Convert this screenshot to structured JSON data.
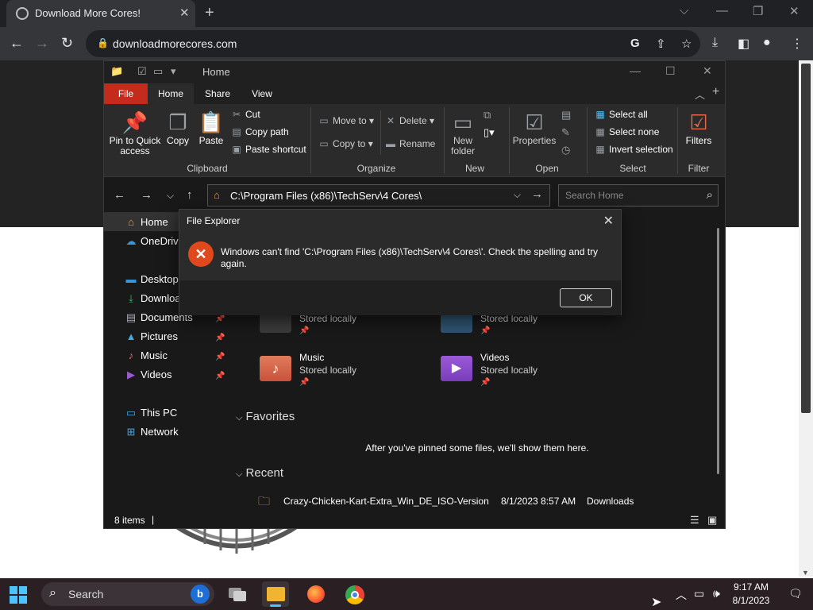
{
  "browser": {
    "tab_title": "Download More Cores!",
    "url": "downloadmorecores.com"
  },
  "explorer": {
    "location_title": "Home",
    "ribbon_tabs": [
      "File",
      "Home",
      "Share",
      "View"
    ],
    "clipboard": {
      "pin_label": "Pin to Quick access",
      "copy_label": "Copy",
      "paste_label": "Paste",
      "cut_label": "Cut",
      "copy_path_label": "Copy path",
      "paste_shortcut_label": "Paste shortcut",
      "group_label": "Clipboard"
    },
    "organize": {
      "move_to_label": "Move to",
      "copy_to_label": "Copy to",
      "delete_label": "Delete",
      "rename_label": "Rename",
      "group_label": "Organize"
    },
    "new": {
      "new_folder_label": "New folder",
      "group_label": "New"
    },
    "open": {
      "properties_label": "Properties",
      "group_label": "Open"
    },
    "select": {
      "select_all_label": "Select all",
      "select_none_label": "Select none",
      "invert_label": "Invert selection",
      "group_label": "Select"
    },
    "filter": {
      "filters_label": "Filters",
      "group_label": "Filter"
    },
    "address_path": "C:\\Program Files (x86)\\TechServ\\4 Cores\\",
    "search_placeholder": "Search Home",
    "nav": [
      {
        "label": "Home",
        "icon": "home-icon"
      },
      {
        "label": "OneDrive",
        "icon": "cloud-icon"
      },
      {
        "label": "Desktop",
        "icon": "desktop-icon"
      },
      {
        "label": "Downloads",
        "icon": "download-icon"
      },
      {
        "label": "Documents",
        "icon": "document-icon"
      },
      {
        "label": "Pictures",
        "icon": "picture-icon"
      },
      {
        "label": "Music",
        "icon": "music-icon"
      },
      {
        "label": "Videos",
        "icon": "video-icon"
      },
      {
        "label": "This PC",
        "icon": "computer-icon"
      },
      {
        "label": "Network",
        "icon": "network-icon"
      }
    ],
    "quick_access": [
      {
        "name": "",
        "status": "Stored locally",
        "icon": "document-folder-icon"
      },
      {
        "name": "",
        "status": "Stored locally",
        "icon": "picture-folder-icon"
      },
      {
        "name": "Music",
        "status": "Stored locally",
        "icon": "music-folder-icon"
      },
      {
        "name": "Videos",
        "status": "Stored locally",
        "icon": "video-folder-icon"
      }
    ],
    "favorites_header": "Favorites",
    "favorites_empty": "After you've pinned some files, we'll show them here.",
    "recent_header": "Recent",
    "recent": [
      {
        "name": "Crazy-Chicken-Kart-Extra_Win_DE_ISO-Version",
        "date": "8/1/2023 8:57 AM",
        "location": "Downloads"
      }
    ],
    "status": "8 items"
  },
  "dialog": {
    "title": "File Explorer",
    "message": "Windows can't find 'C:\\Program Files (x86)\\TechServ\\4 Cores\\'. Check the spelling and try again.",
    "ok_label": "OK"
  },
  "taskbar": {
    "search_label": "Search",
    "time": "9:17 AM",
    "date": "8/1/2023"
  },
  "colors": {
    "accent_file_tab": "#c42b1c",
    "error_icon": "#e0481d",
    "windows_logo": "#4cc2ff"
  }
}
